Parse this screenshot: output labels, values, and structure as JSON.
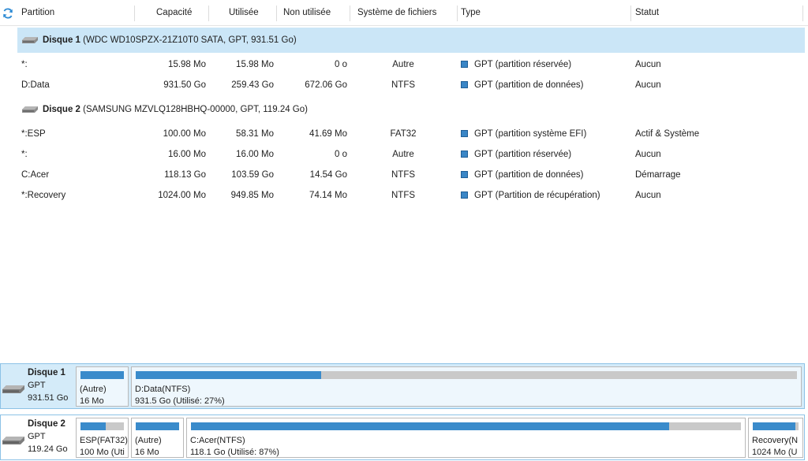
{
  "columns": {
    "partition": "Partition",
    "capacity": "Capacité",
    "used": "Utilisée",
    "unused": "Non utilisée",
    "filesystem": "Système de fichiers",
    "type": "Type",
    "status": "Statut"
  },
  "disk1": {
    "name": "Disque 1",
    "details": "(WDC WD10SPZX-21Z10T0 SATA, GPT, 931.51 Go)",
    "partitions": [
      {
        "name": "*:",
        "capacity": "15.98 Mo",
        "used": "15.98 Mo",
        "unused": "0 o",
        "fs": "Autre",
        "type": "GPT (partition réservée)",
        "status": "Aucun"
      },
      {
        "name": "D:Data",
        "capacity": "931.50 Go",
        "used": "259.43 Go",
        "unused": "672.06 Go",
        "fs": "NTFS",
        "type": "GPT (partition de données)",
        "status": "Aucun"
      }
    ]
  },
  "disk2": {
    "name": "Disque 2",
    "details": "(SAMSUNG MZVLQ128HBHQ-00000, GPT, 119.24 Go)",
    "partitions": [
      {
        "name": "*:ESP",
        "capacity": "100.00 Mo",
        "used": "58.31 Mo",
        "unused": "41.69 Mo",
        "fs": "FAT32",
        "type": "GPT (partition système EFI)",
        "status": "Actif & Système"
      },
      {
        "name": "*:",
        "capacity": "16.00 Mo",
        "used": "16.00 Mo",
        "unused": "0 o",
        "fs": "Autre",
        "type": "GPT (partition réservée)",
        "status": "Aucun"
      },
      {
        "name": "C:Acer",
        "capacity": "118.13 Go",
        "used": "103.59 Go",
        "unused": "14.54 Go",
        "fs": "NTFS",
        "type": "GPT (partition de données)",
        "status": "Démarrage"
      },
      {
        "name": "*:Recovery",
        "capacity": "1024.00 Mo",
        "used": "949.85 Mo",
        "unused": "74.14 Mo",
        "fs": "NTFS",
        "type": "GPT (Partition de récupération)",
        "status": "Aucun"
      }
    ]
  },
  "map": {
    "disk1": {
      "name": "Disque 1",
      "type": "GPT",
      "size": "931.51 Go",
      "parts": [
        {
          "l1": "(Autre)",
          "l2": "16 Mo",
          "used_fraction": 1.0
        },
        {
          "l1": "D:Data(NTFS)",
          "l2": "931.5 Go (Utilisé: 27%)",
          "used_fraction": 0.28
        }
      ]
    },
    "disk2": {
      "name": "Disque 2",
      "type": "GPT",
      "size": "119.24 Go",
      "parts": [
        {
          "l1": "ESP(FAT32)",
          "l2": "100 Mo (Uti",
          "used_fraction": 0.58
        },
        {
          "l1": "(Autre)",
          "l2": "16 Mo",
          "used_fraction": 1.0
        },
        {
          "l1": "C:Acer(NTFS)",
          "l2": "118.1 Go (Utilisé: 87%)",
          "used_fraction": 0.87
        },
        {
          "l1": "Recovery(N",
          "l2": "1024 Mo (U",
          "used_fraction": 0.93
        }
      ]
    }
  },
  "colors": {
    "accent": "#3a8bcb",
    "selection": "#cbe6f7",
    "bar_empty": "#c9c9c9"
  },
  "icons": {
    "refresh": "refresh-icon",
    "disk": "hard-disk-icon",
    "type": "partition-type-icon"
  }
}
